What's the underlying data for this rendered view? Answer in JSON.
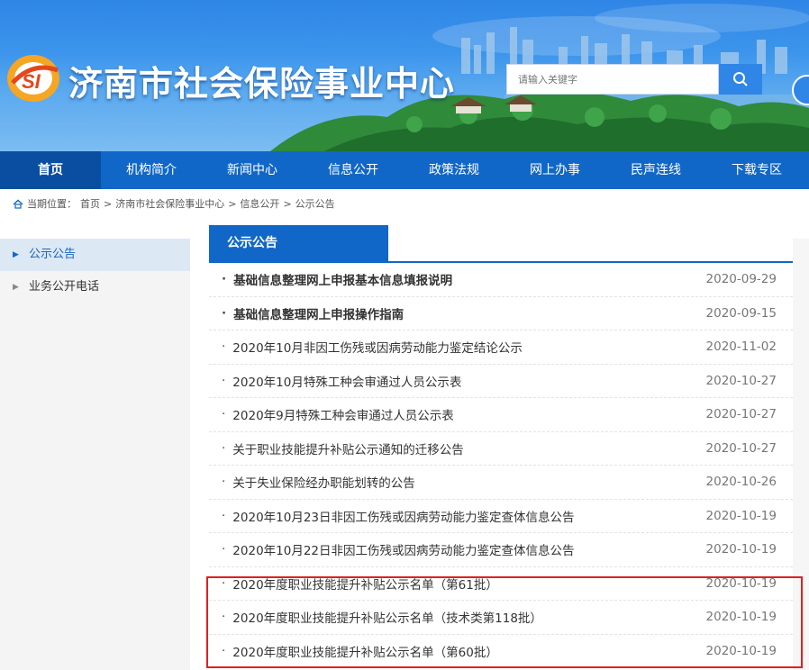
{
  "header": {
    "site_title": "济南市社会保险事业中心",
    "logo_text": "SI",
    "search_placeholder": "请输入关键字"
  },
  "nav": {
    "items": [
      {
        "label": "首页"
      },
      {
        "label": "机构简介"
      },
      {
        "label": "新闻中心"
      },
      {
        "label": "信息公开"
      },
      {
        "label": "政策法规"
      },
      {
        "label": "网上办事"
      },
      {
        "label": "民声连线"
      },
      {
        "label": "下载专区"
      }
    ]
  },
  "breadcrumb": {
    "prefix": "当期位置：",
    "items": [
      "首页",
      "济南市社会保险事业中心",
      "信息公开",
      "公示公告"
    ]
  },
  "sidebar": {
    "items": [
      {
        "label": "公示公告"
      },
      {
        "label": "业务公开电话"
      }
    ]
  },
  "panel": {
    "title": "公示公告",
    "items": [
      {
        "title": "基础信息整理网上申报基本信息填报说明",
        "date": "2020-09-29"
      },
      {
        "title": "基础信息整理网上申报操作指南",
        "date": "2020-09-15"
      },
      {
        "title": "2020年10月非因工伤残或因病劳动能力鉴定结论公示",
        "date": "2020-11-02"
      },
      {
        "title": "2020年10月特殊工种会审通过人员公示表",
        "date": "2020-10-27"
      },
      {
        "title": "2020年9月特殊工种会审通过人员公示表",
        "date": "2020-10-27"
      },
      {
        "title": "关于职业技能提升补贴公示通知的迁移公告",
        "date": "2020-10-27"
      },
      {
        "title": "关于失业保险经办职能划转的公告",
        "date": "2020-10-26"
      },
      {
        "title": "2020年10月23日非因工伤残或因病劳动能力鉴定查体信息公告",
        "date": "2020-10-19"
      },
      {
        "title": "2020年10月22日非因工伤残或因病劳动能力鉴定查体信息公告",
        "date": "2020-10-19"
      },
      {
        "title": "2020年度职业技能提升补贴公示名单（第61批）",
        "date": "2020-10-19"
      },
      {
        "title": "2020年度职业技能提升补贴公示名单（技术类第118批）",
        "date": "2020-10-19"
      },
      {
        "title": "2020年度职业技能提升补贴公示名单（第60批）",
        "date": "2020-10-19"
      }
    ]
  },
  "colors": {
    "nav_bg": "#1167c8",
    "nav_active": "#0a4ea2",
    "highlight": "#e02020",
    "accent_blue": "#1466c6"
  }
}
